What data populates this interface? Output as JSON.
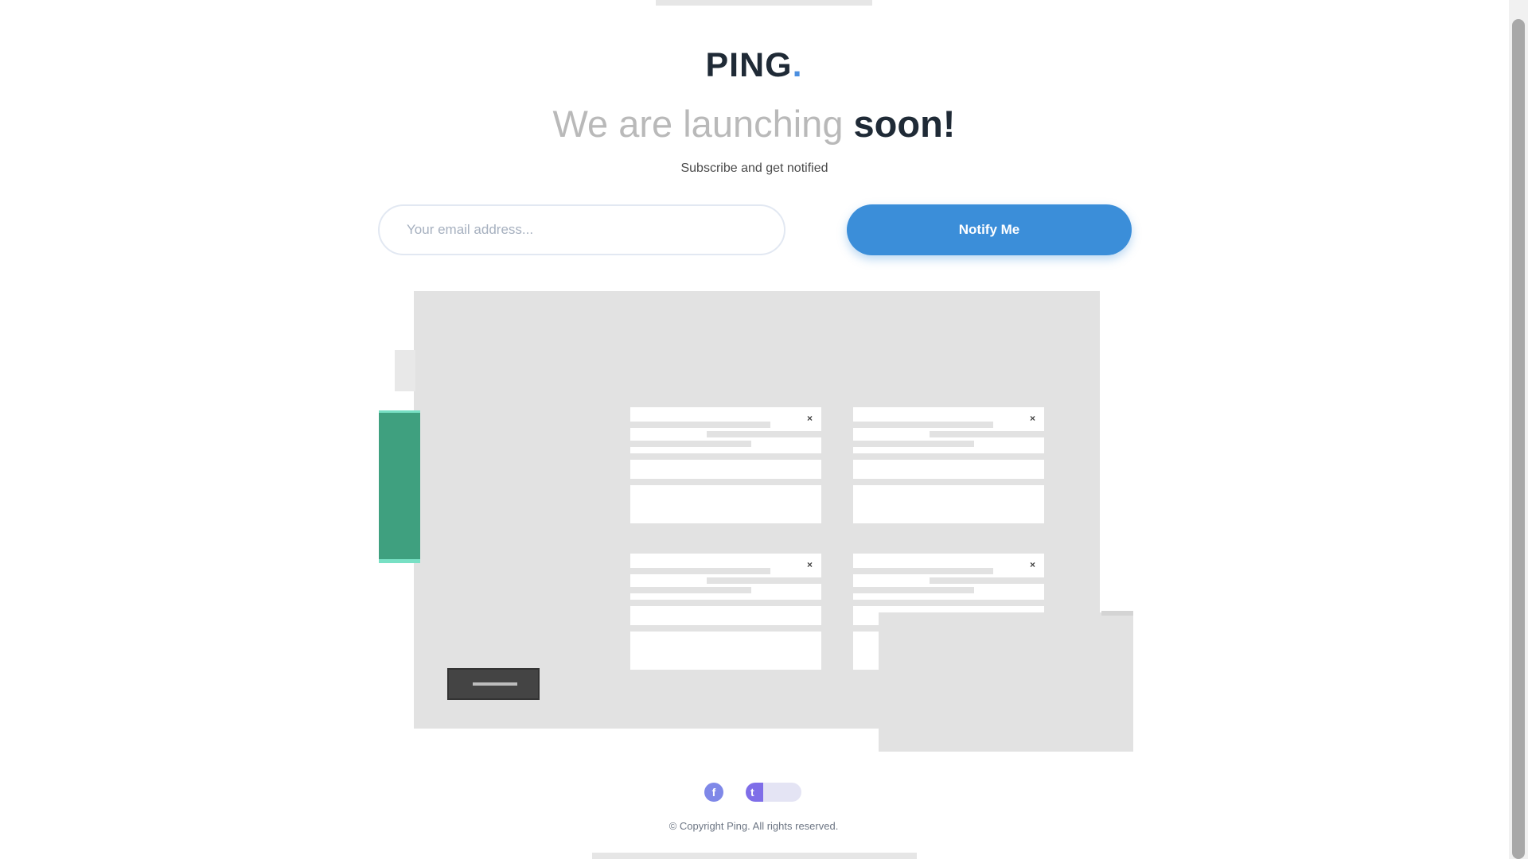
{
  "brand": {
    "logo_text": "PING",
    "logo_dot": "."
  },
  "headline": {
    "muted": "We are launching",
    "strong": "soon!"
  },
  "subscribe": {
    "text": "Subscribe and get notified",
    "email_placeholder": "Your email address...",
    "notify_label": "Notify Me"
  },
  "dashboard": {
    "cards": [
      {
        "close": "×"
      },
      {
        "close": "×"
      },
      {
        "close": "×"
      },
      {
        "close": "×"
      }
    ]
  },
  "footer": {
    "social": [
      {
        "icon": "facebook-icon",
        "glyph": "f"
      },
      {
        "icon": "twitter-icon",
        "glyph": "t"
      },
      {
        "icon": "instagram-icon",
        "glyph": "◎"
      }
    ],
    "copyright": "© Copyright Ping. All rights reserved."
  },
  "colors": {
    "accent": "#3b8ed9",
    "brand_dark": "#1f2a36",
    "green": "#3fa07f"
  }
}
